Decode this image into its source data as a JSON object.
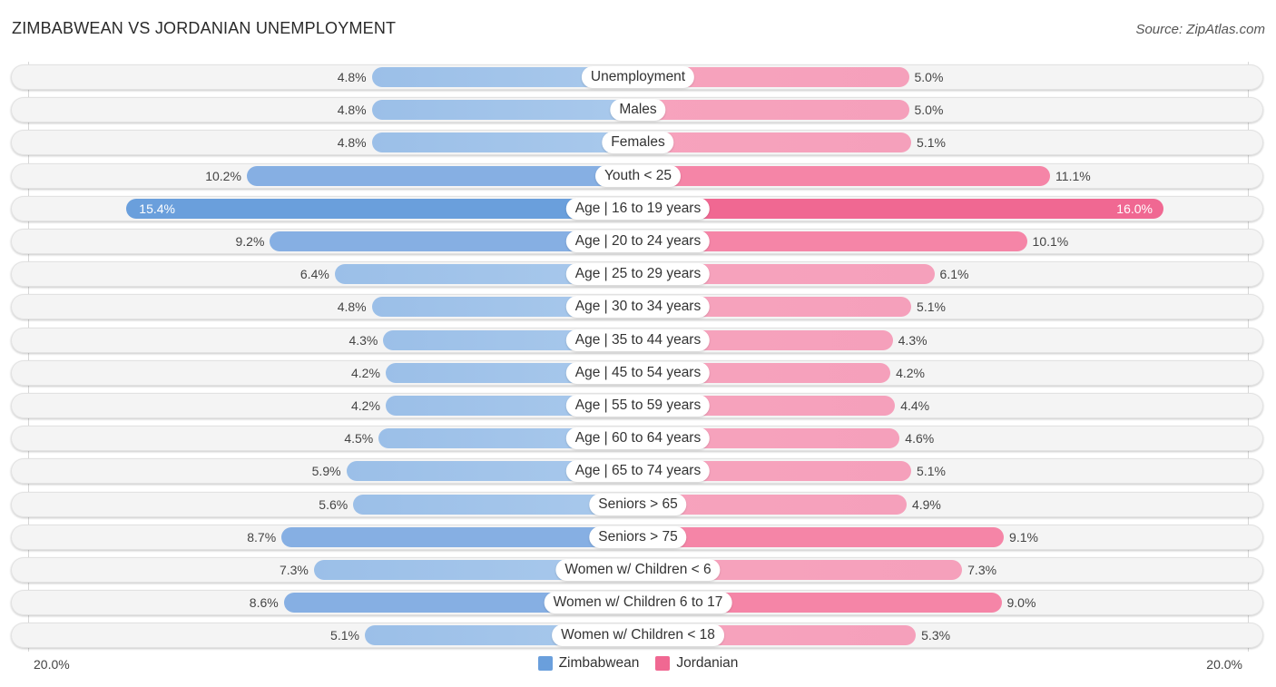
{
  "header": {
    "title": "ZIMBABWEAN VS JORDANIAN UNEMPLOYMENT",
    "source": "Source: ZipAtlas.com"
  },
  "colors": {
    "zimbabwean": "#6a9fdc",
    "jordanian": "#f06892"
  },
  "chart_data": {
    "type": "bar",
    "orientation": "horizontal-diverging",
    "title": "ZIMBABWEAN VS JORDANIAN UNEMPLOYMENT",
    "xlabel": "",
    "ylabel": "",
    "xlim": [
      0,
      20
    ],
    "axis_labels": {
      "left": "20.0%",
      "right": "20.0%"
    },
    "legend_position": "bottom-center",
    "categories": [
      "Unemployment",
      "Males",
      "Females",
      "Youth < 25",
      "Age | 16 to 19 years",
      "Age | 20 to 24 years",
      "Age | 25 to 29 years",
      "Age | 30 to 34 years",
      "Age | 35 to 44 years",
      "Age | 45 to 54 years",
      "Age | 55 to 59 years",
      "Age | 60 to 64 years",
      "Age | 65 to 74 years",
      "Seniors > 65",
      "Seniors > 75",
      "Women w/ Children < 6",
      "Women w/ Children 6 to 17",
      "Women w/ Children < 18"
    ],
    "series": [
      {
        "name": "Zimbabwean",
        "values": [
          4.8,
          4.8,
          4.8,
          10.2,
          15.4,
          9.2,
          6.4,
          4.8,
          4.3,
          4.2,
          4.2,
          4.5,
          5.9,
          5.6,
          8.7,
          7.3,
          8.6,
          5.1
        ],
        "labels": [
          "4.8%",
          "4.8%",
          "4.8%",
          "10.2%",
          "15.4%",
          "9.2%",
          "6.4%",
          "4.8%",
          "4.3%",
          "4.2%",
          "4.2%",
          "4.5%",
          "5.9%",
          "5.6%",
          "8.7%",
          "7.3%",
          "8.6%",
          "5.1%"
        ]
      },
      {
        "name": "Jordanian",
        "values": [
          5.0,
          5.0,
          5.1,
          11.1,
          16.0,
          10.1,
          6.1,
          5.1,
          4.3,
          4.2,
          4.4,
          4.6,
          5.1,
          4.9,
          9.1,
          7.3,
          9.0,
          5.3
        ],
        "labels": [
          "5.0%",
          "5.0%",
          "5.1%",
          "11.1%",
          "16.0%",
          "10.1%",
          "6.1%",
          "5.1%",
          "4.3%",
          "4.2%",
          "4.4%",
          "4.6%",
          "5.1%",
          "4.9%",
          "9.1%",
          "7.3%",
          "9.0%",
          "5.3%"
        ]
      }
    ]
  },
  "legend": [
    {
      "label": "Zimbabwean"
    },
    {
      "label": "Jordanian"
    }
  ]
}
